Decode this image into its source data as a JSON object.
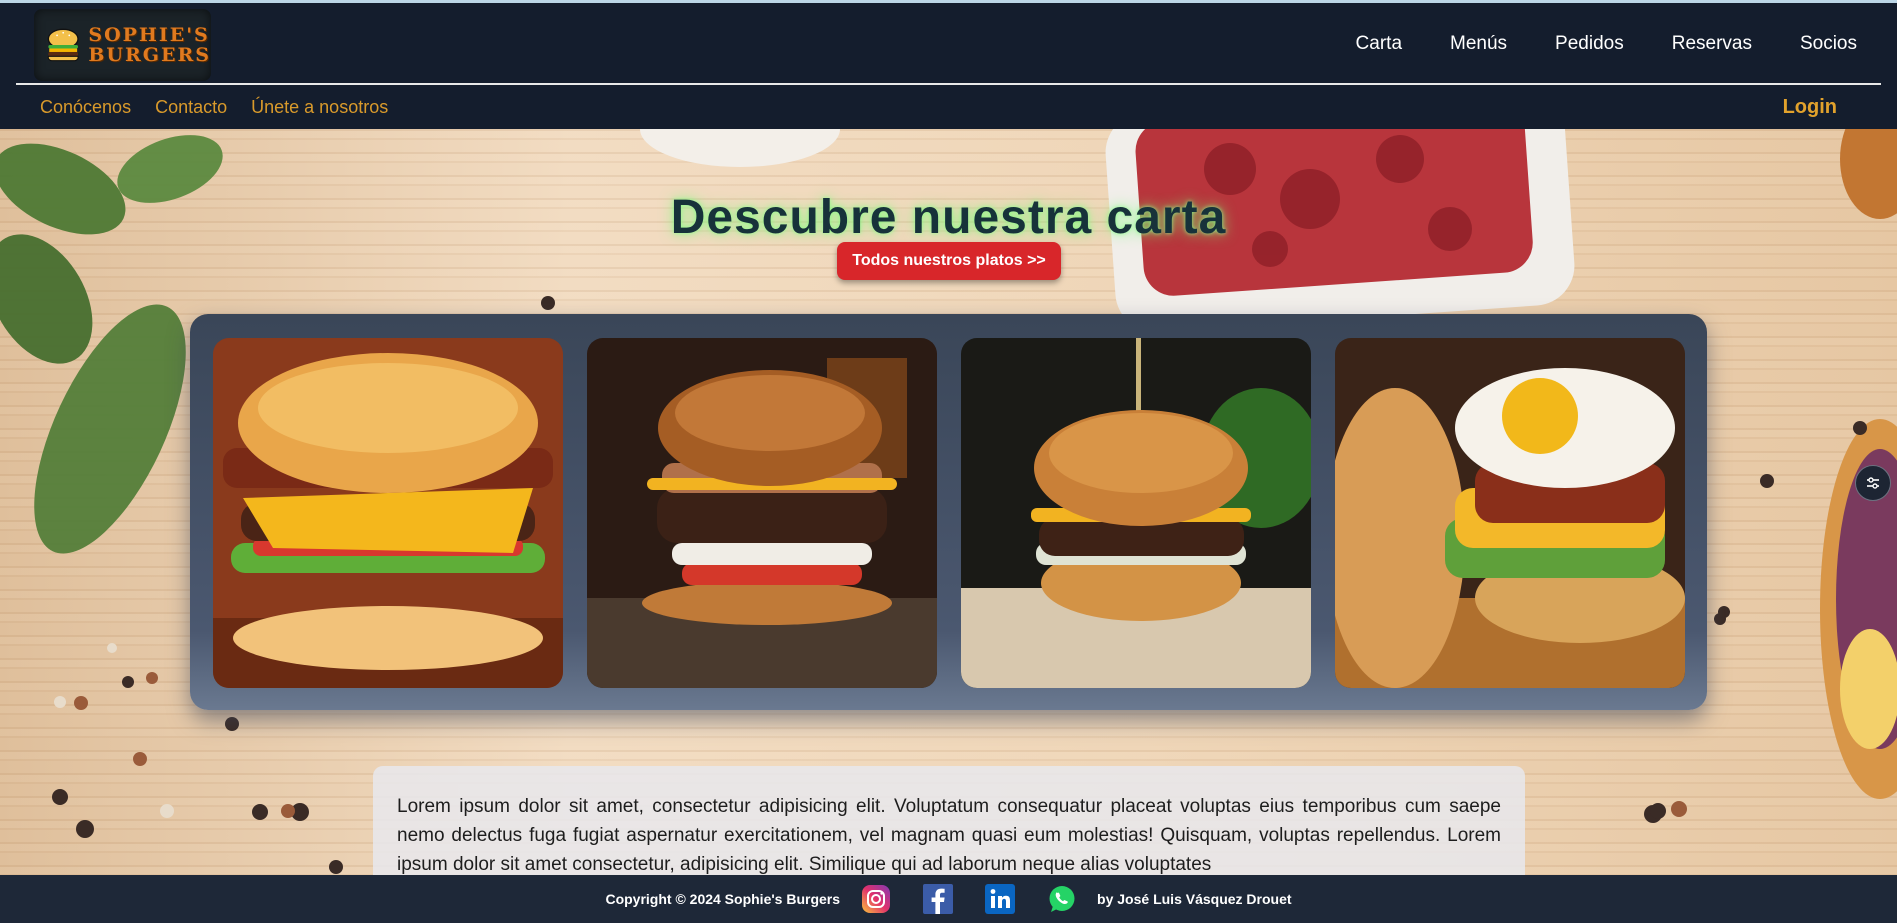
{
  "brand": {
    "logo_line1": "SOPHIE'S",
    "logo_line2": "BURGERS"
  },
  "main_nav": [
    "Carta",
    "Menús",
    "Pedidos",
    "Reservas",
    "Socios"
  ],
  "sub_nav": [
    "Conócenos",
    "Contacto",
    "Únete a nosotros"
  ],
  "login_label": "Login",
  "hero": {
    "title": "Descubre nuestra carta",
    "cta_label": "Todos nuestros platos >>"
  },
  "body_text": "Lorem ipsum dolor sit amet, consectetur adipisicing elit. Voluptatum consequatur placeat voluptas eius temporibus cum saepe nemo delectus fuga fugiat aspernatur exercitationem, vel magnam quasi eum molestias! Quisquam, voluptas repellendus. Lorem ipsum dolor sit amet consectetur, adipisicing elit. Similique qui ad laborum neque alias voluptates",
  "footer": {
    "copyright": "Copyright © 2024 Sophie's Burgers",
    "credit": "by José Luis Vásquez Drouet",
    "social_icons": [
      "instagram-icon",
      "facebook-icon",
      "linkedin-icon",
      "whatsapp-icon"
    ]
  },
  "colors": {
    "header_bg": "#141d2d",
    "nav_accent": "#d99a2b",
    "cta": "#d8262a",
    "gallery_panel": "#3a4658",
    "footer_bg": "#1e2838"
  }
}
